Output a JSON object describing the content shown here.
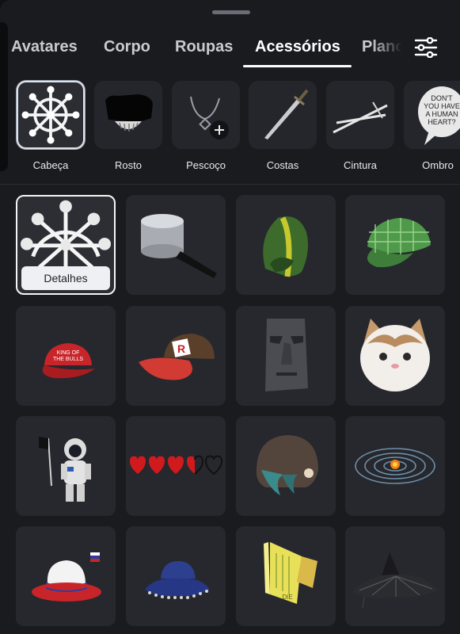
{
  "tabs": [
    {
      "label": "Avatares",
      "active": false
    },
    {
      "label": "Corpo",
      "active": false
    },
    {
      "label": "Roupas",
      "active": false
    },
    {
      "label": "Acessórios",
      "active": true
    },
    {
      "label": "Plano",
      "active": false
    }
  ],
  "filter_icon": "sliders-icon",
  "subcategories": [
    {
      "label": "Cabeça",
      "icon": "ship-wheel-icon",
      "selected": true
    },
    {
      "label": "Rosto",
      "icon": "face-accessory-icon",
      "selected": false
    },
    {
      "label": "Pescoço",
      "icon": "necklace-add-icon",
      "selected": false
    },
    {
      "label": "Costas",
      "icon": "sword-icon",
      "selected": false
    },
    {
      "label": "Cintura",
      "icon": "crossed-swords-icon",
      "selected": false
    },
    {
      "label": "Ombro",
      "icon": "speech-bubble-icon",
      "selected": false,
      "bubble_text": "DON'T YOU HAVE A HUMAN HEART?"
    }
  ],
  "items": [
    {
      "name": "ship-wheel-hat",
      "selected": true,
      "button_label": "Detalhes"
    },
    {
      "name": "cooking-pot-hat"
    },
    {
      "name": "green-hood"
    },
    {
      "name": "green-plaid-cap"
    },
    {
      "name": "red-bulls-cap",
      "cap_text": "KING OF THE BULLS"
    },
    {
      "name": "roblox-cap"
    },
    {
      "name": "moai-head"
    },
    {
      "name": "cat-head"
    },
    {
      "name": "astronaut-figure"
    },
    {
      "name": "pixel-hearts"
    },
    {
      "name": "brown-helmet"
    },
    {
      "name": "solar-system-halo"
    },
    {
      "name": "tricolor-fedora"
    },
    {
      "name": "blue-bucket-hat"
    },
    {
      "name": "yellow-sign-hat",
      "sign_text": "DIE"
    },
    {
      "name": "black-witch-hat"
    }
  ],
  "colors": {
    "background": "#1a1b1f",
    "card": "#26282d",
    "accent": "#ffffff"
  }
}
